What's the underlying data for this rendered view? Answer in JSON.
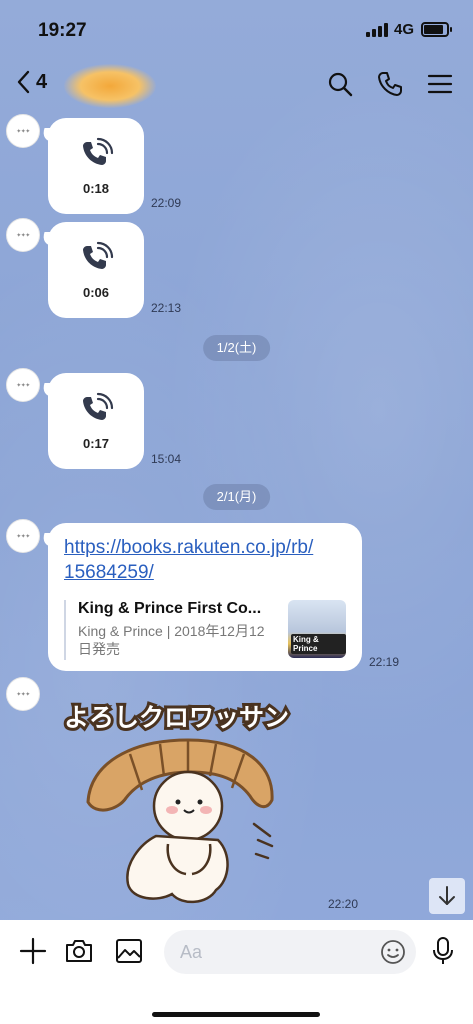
{
  "status_bar": {
    "time": "19:27",
    "network": "4G"
  },
  "header": {
    "back_count": "4"
  },
  "messages": [
    {
      "type": "call",
      "duration": "0:18",
      "time": "22:09"
    },
    {
      "type": "call",
      "duration": "0:06",
      "time": "22:13"
    },
    {
      "type": "call",
      "duration": "0:17",
      "time": "15:04"
    },
    {
      "type": "link",
      "url_line1": "https://books.rakuten.co.jp/rb/",
      "url_line2": "15684259/",
      "preview_title": "King & Prince First Co...",
      "preview_desc": "King & Prince | 2018年12月12日発売",
      "thumb_label": "King & Prince",
      "time": "22:19"
    },
    {
      "type": "sticker",
      "text": "よろしクロワッサン",
      "time": "22:20"
    }
  ],
  "date_separators": [
    "1/2(土)",
    "2/1(月)"
  ],
  "input": {
    "placeholder": "Aa"
  },
  "colors": {
    "background": "#8fa7d6",
    "link": "#2a5fbf",
    "bubble": "#ffffff"
  },
  "icons": [
    "back-chevron-icon",
    "search-icon",
    "phone-icon",
    "menu-icon",
    "call-icon",
    "plus-icon",
    "camera-icon",
    "image-icon",
    "emoji-icon",
    "microphone-icon",
    "arrow-down-icon"
  ]
}
